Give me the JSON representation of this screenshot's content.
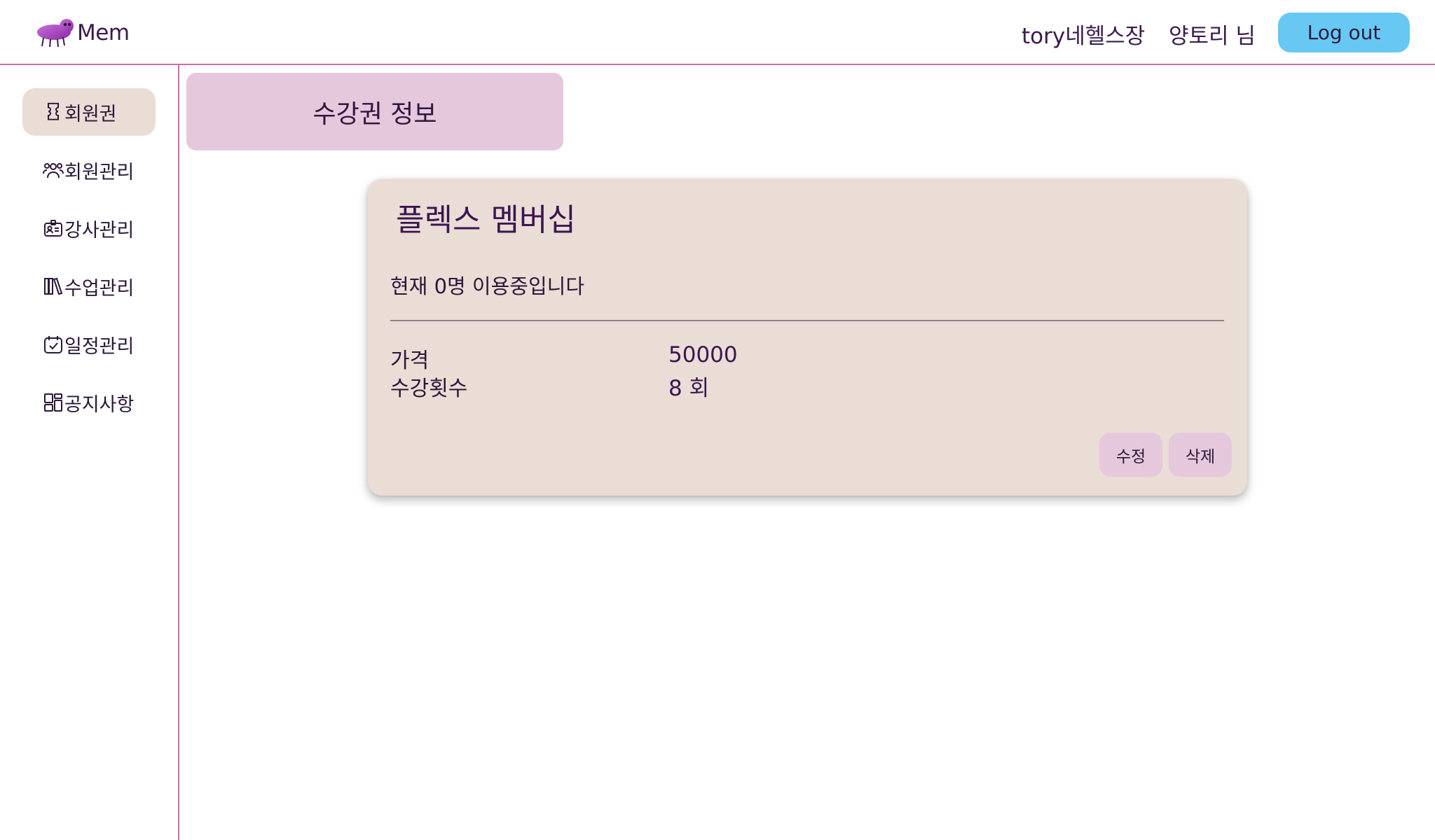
{
  "header": {
    "brand_name": "Mem",
    "gym_name": "tory네헬스장",
    "user_name": "양토리 님",
    "logout_label": "Log out"
  },
  "sidebar": {
    "items": [
      {
        "label": "회원권",
        "icon": "ticket-icon",
        "active": true
      },
      {
        "label": "회원관리",
        "icon": "users-icon",
        "active": false
      },
      {
        "label": "강사관리",
        "icon": "id-badge-icon",
        "active": false
      },
      {
        "label": "수업관리",
        "icon": "books-icon",
        "active": false
      },
      {
        "label": "일정관리",
        "icon": "calendar-check-icon",
        "active": false
      },
      {
        "label": "공지사항",
        "icon": "layout-icon",
        "active": false
      }
    ]
  },
  "main": {
    "page_title": "수강권 정보",
    "card": {
      "title": "플렉스 멤버십",
      "status": "현재 0명 이용중입니다",
      "rows": [
        {
          "label": "가격",
          "value": "50000"
        },
        {
          "label": "수강횟수",
          "value": "8 회"
        }
      ],
      "edit_label": "수정",
      "delete_label": "삭제"
    }
  },
  "colors": {
    "accent_line": "#d26aa8",
    "logout_button": "#67c8f3",
    "title_box": "#e6c8dd",
    "card_background": "#e9ddd6",
    "active_nav": "#eaddd6"
  }
}
